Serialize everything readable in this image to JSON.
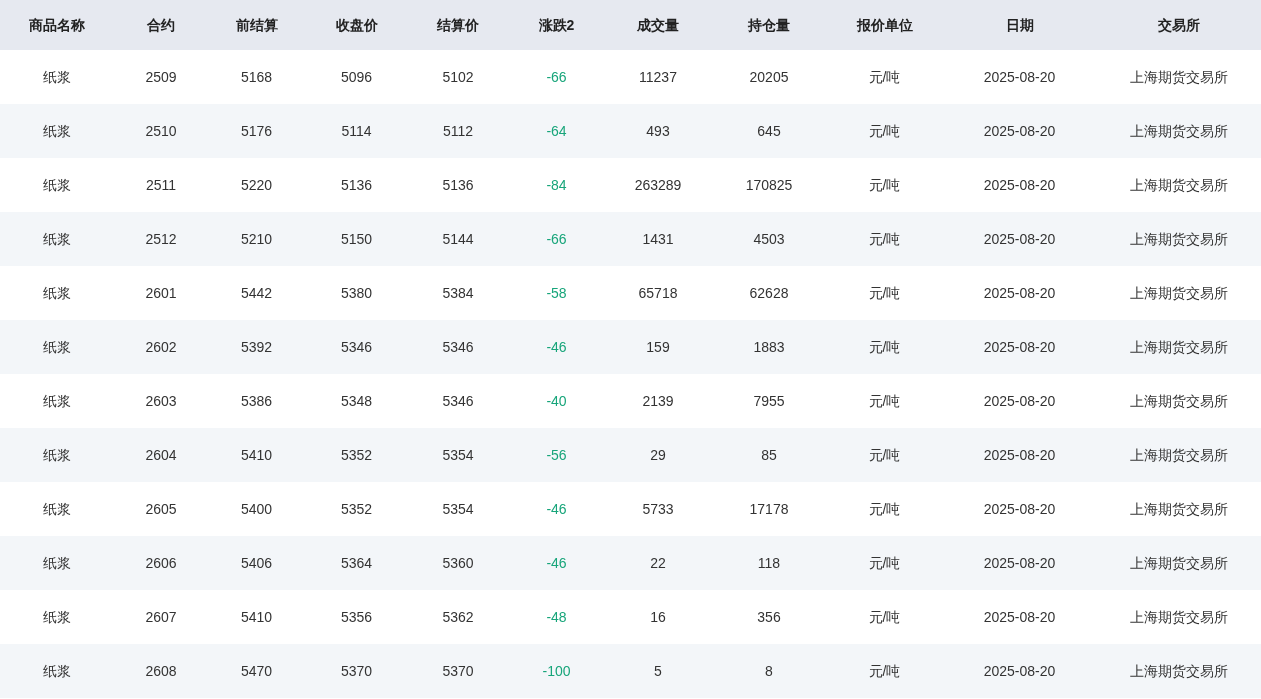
{
  "table": {
    "columns": [
      "商品名称",
      "合约",
      "前结算",
      "收盘价",
      "结算价",
      "涨跌2",
      "成交量",
      "持仓量",
      "报价单位",
      "日期",
      "交易所"
    ],
    "rows": [
      {
        "cells": [
          "纸浆",
          "2509",
          "5168",
          "5096",
          "5102",
          "-66",
          "11237",
          "20205",
          "元/吨",
          "2025-08-20",
          "上海期货交易所"
        ],
        "color": "#17a57a"
      },
      {
        "cells": [
          "纸浆",
          "2510",
          "5176",
          "5114",
          "5112",
          "-64",
          "493",
          "645",
          "元/吨",
          "2025-08-20",
          "上海期货交易所"
        ],
        "color": "#17a57a"
      },
      {
        "cells": [
          "纸浆",
          "2511",
          "5220",
          "5136",
          "5136",
          "-84",
          "263289",
          "170825",
          "元/吨",
          "2025-08-20",
          "上海期货交易所"
        ],
        "color": "#17a57a"
      },
      {
        "cells": [
          "纸浆",
          "2512",
          "5210",
          "5150",
          "5144",
          "-66",
          "1431",
          "4503",
          "元/吨",
          "2025-08-20",
          "上海期货交易所"
        ],
        "color": "#17a57a"
      },
      {
        "cells": [
          "纸浆",
          "2601",
          "5442",
          "5380",
          "5384",
          "-58",
          "65718",
          "62628",
          "元/吨",
          "2025-08-20",
          "上海期货交易所"
        ],
        "color": "#17a57a"
      },
      {
        "cells": [
          "纸浆",
          "2602",
          "5392",
          "5346",
          "5346",
          "-46",
          "159",
          "1883",
          "元/吨",
          "2025-08-20",
          "上海期货交易所"
        ],
        "color": "#17a57a"
      },
      {
        "cells": [
          "纸浆",
          "2603",
          "5386",
          "5348",
          "5346",
          "-40",
          "2139",
          "7955",
          "元/吨",
          "2025-08-20",
          "上海期货交易所"
        ],
        "color": "#17a57a"
      },
      {
        "cells": [
          "纸浆",
          "2604",
          "5410",
          "5352",
          "5354",
          "-56",
          "29",
          "85",
          "元/吨",
          "2025-08-20",
          "上海期货交易所"
        ],
        "color": "#17a57a"
      },
      {
        "cells": [
          "纸浆",
          "2605",
          "5400",
          "5352",
          "5354",
          "-46",
          "5733",
          "17178",
          "元/吨",
          "2025-08-20",
          "上海期货交易所"
        ],
        "color": "#17a57a"
      },
      {
        "cells": [
          "纸浆",
          "2606",
          "5406",
          "5364",
          "5360",
          "-46",
          "22",
          "118",
          "元/吨",
          "2025-08-20",
          "上海期货交易所"
        ],
        "color": "#17a57a"
      },
      {
        "cells": [
          "纸浆",
          "2607",
          "5410",
          "5356",
          "5362",
          "-48",
          "16",
          "356",
          "元/吨",
          "2025-08-20",
          "上海期货交易所"
        ],
        "color": "#17a57a"
      },
      {
        "cells": [
          "纸浆",
          "2608",
          "5470",
          "5370",
          "5370",
          "-100",
          "5",
          "8",
          "元/吨",
          "2025-08-20",
          "上海期货交易所"
        ],
        "color": "#17a57a"
      }
    ]
  }
}
